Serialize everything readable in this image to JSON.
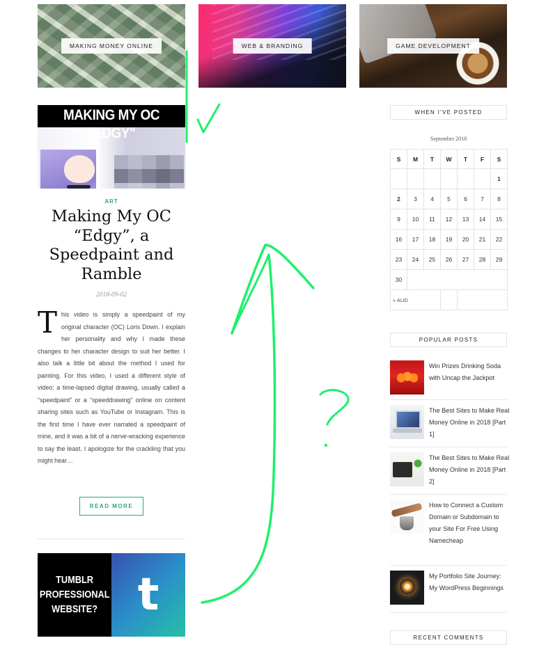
{
  "categories": [
    {
      "label": "MAKING MONEY ONLINE"
    },
    {
      "label": "WEB & BRANDING"
    },
    {
      "label": "GAME DEVELOPMENT"
    }
  ],
  "post": {
    "thumbnail_title": "MAKING MY OC \"EDGY\"",
    "category": "ART",
    "title": "Making My OC “Edgy”, a Speedpaint and Ramble",
    "date": "2018-09-02",
    "excerpt_dropcap": "T",
    "excerpt_rest": "his video is simply a speedpaint of my original character (OC) Loris Down. I explain her personality and why I made these changes to her character design to suit her better. I also talk a little bit about the method I used for painting. For this video, I used a different style of video: a time-lapsed digital drawing, usually called a “speedpaint” or a “speeddrawing” online on content sharing sites such as YouTube or Instagram. This is the first time I have ever narrated a speedpaint of mine, and it was a bit of a nerve-wracking experience to say the least. I apologize for the crackling that you might hear…",
    "read_more": "READ MORE"
  },
  "next_post": {
    "thumbnail_text": "TUMBLR PROFESSIONAL WEBSITE?",
    "thumbnail_logo": "t"
  },
  "sidebar": {
    "calendar_title": "WHEN I'VE POSTED",
    "calendar_caption": "September 2018",
    "weekdays": [
      "S",
      "M",
      "T",
      "W",
      "T",
      "F",
      "S"
    ],
    "weeks": [
      [
        "",
        "",
        "",
        "",
        "",
        "",
        "1"
      ],
      [
        "2",
        "3",
        "4",
        "5",
        "6",
        "7",
        "8"
      ],
      [
        "9",
        "10",
        "11",
        "12",
        "13",
        "14",
        "15"
      ],
      [
        "16",
        "17",
        "18",
        "19",
        "20",
        "21",
        "22"
      ],
      [
        "23",
        "24",
        "25",
        "26",
        "27",
        "28",
        "29"
      ],
      [
        "30",
        "",
        "",
        "",
        "",
        "",
        ""
      ]
    ],
    "calendar_prev": "« AUG",
    "popular_title": "POPULAR POSTS",
    "popular_posts": [
      {
        "title": "Win Prizes Drinking Soda with Uncap the Jackpot"
      },
      {
        "title": "The Best Sites to Make Real Money Online in 2018 [Part 1]"
      },
      {
        "title": "The Best Sites to Make Real Money Online in 2018 [Part 2]"
      },
      {
        "title": "How to Connect a Custom Domain or Subdomain to your Site For Free Using Namecheap"
      },
      {
        "title": "My Portfolio Site Journey: My WordPress Beginnings"
      }
    ],
    "recent_comments_title": "RECENT COMMENTS"
  },
  "annotation": {
    "question_mark": "?",
    "stroke_color": "#1ef06a"
  }
}
